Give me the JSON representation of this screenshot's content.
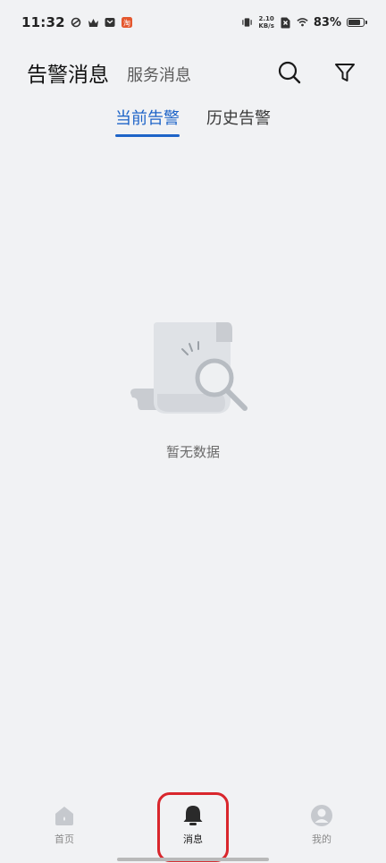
{
  "status_bar": {
    "time": "11:32",
    "net_speed_value": "2.10",
    "net_speed_unit": "KB/s",
    "battery_percent": "83%",
    "battery_level": 0.83
  },
  "header": {
    "title": "告警消息",
    "secondary_tab": "服务消息"
  },
  "tabs": [
    {
      "label": "当前告警",
      "active": true
    },
    {
      "label": "历史告警",
      "active": false
    }
  ],
  "empty_state": {
    "text": "暂无数据"
  },
  "bottom_nav": [
    {
      "label": "首页",
      "icon": "home-icon",
      "active": false
    },
    {
      "label": "消息",
      "icon": "bell-icon",
      "active": true
    },
    {
      "label": "我的",
      "icon": "profile-icon",
      "active": false
    }
  ],
  "colors": {
    "accent": "#1e64c8",
    "background": "#f1f2f4",
    "highlight": "#d9262c"
  }
}
